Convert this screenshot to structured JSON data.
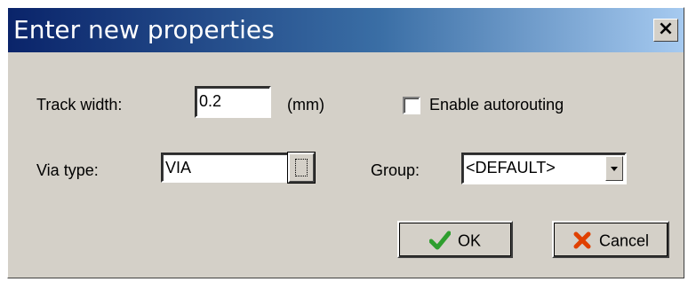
{
  "window": {
    "title": "Enter new properties",
    "close_label": "×"
  },
  "fields": {
    "track_width": {
      "label": "Track width:",
      "value": "0.2",
      "unit": "(mm)"
    },
    "autorouting": {
      "label": "Enable autorouting",
      "checked": false
    },
    "via_type": {
      "label": "Via type:",
      "value": "VIA"
    },
    "group": {
      "label": "Group:",
      "value": "<DEFAULT>"
    }
  },
  "buttons": {
    "ok": "OK",
    "cancel": "Cancel"
  },
  "colors": {
    "ok_check": "#2e9e2e",
    "cancel_x": "#e04000",
    "title_start": "#0a246a",
    "title_end": "#a6caf0"
  }
}
